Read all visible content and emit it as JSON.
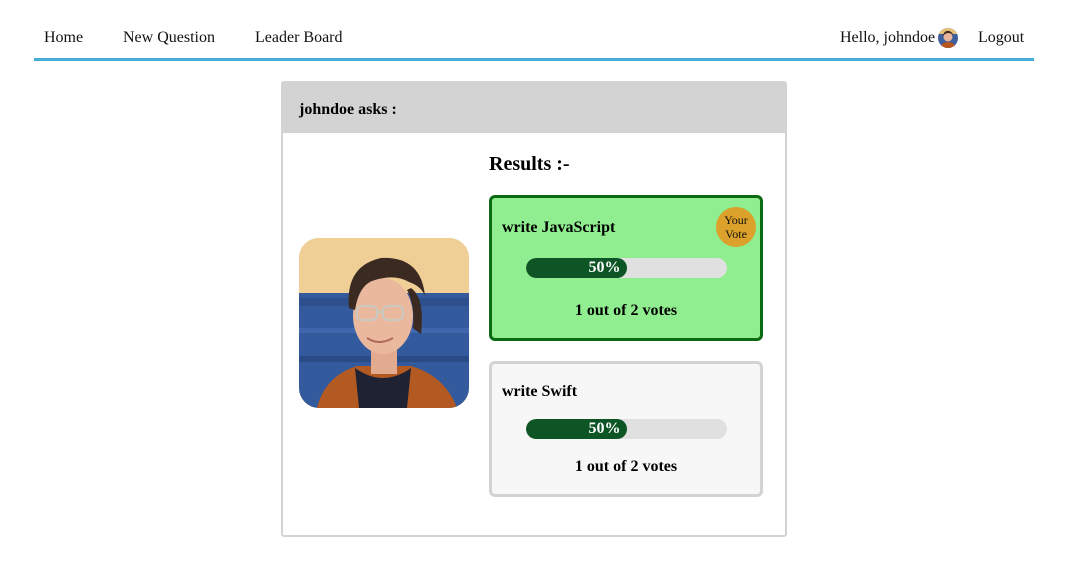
{
  "nav": {
    "home": "Home",
    "new_question": "New Question",
    "leader_board": "Leader Board",
    "greeting": "Hello, johndoe",
    "logout": "Logout"
  },
  "question": {
    "header": "johndoe asks :",
    "results_title": "Results :-",
    "options": [
      {
        "text": "write JavaScript",
        "percent_label": "50%",
        "percent": 50,
        "votes_label": "1 out of 2 votes",
        "is_user_vote": true,
        "badge_line1": "Your",
        "badge_line2": "Vote"
      },
      {
        "text": "write Swift",
        "percent_label": "50%",
        "percent": 50,
        "votes_label": "1 out of 2 votes",
        "is_user_vote": false
      }
    ]
  },
  "colors": {
    "nav_underline": "#45aed6",
    "voted_bg": "#90ee90",
    "voted_border": "#0b6b13",
    "bar_fill": "#0d5524",
    "badge": "#dba12a",
    "header_bg": "#d3d3d3"
  }
}
